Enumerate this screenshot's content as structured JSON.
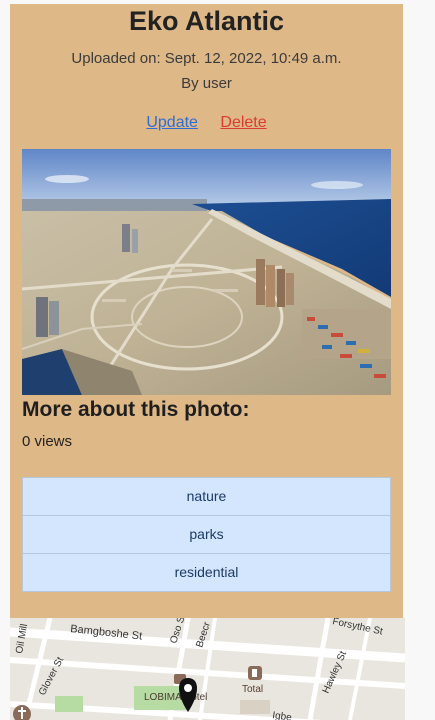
{
  "photo": {
    "title": "Eko Atlantic",
    "uploaded": "Uploaded on: Sept. 12, 2022, 10:49 a.m.",
    "byline": "By user",
    "image_alt": "Eko Atlantic"
  },
  "actions": {
    "update_label": "Update",
    "delete_label": "Delete"
  },
  "details": {
    "heading": "More about this photo:",
    "views": "0 views",
    "tags": [
      "nature",
      "parks",
      "residential"
    ]
  },
  "map": {
    "streets": [
      "Bamgboshe St",
      "Oso St",
      "Beecr",
      "Forsythe St",
      "Oil Mill",
      "Glover St",
      "Hawley St",
      "Total",
      "LOBIMA Hotel",
      "Igbe"
    ],
    "icons": [
      "location-pin-icon",
      "fuel-station-icon",
      "hotel-icon",
      "church-icon"
    ]
  },
  "colors": {
    "card_bg": "#dfb888",
    "tag_bg": "#d4e6fd",
    "update_link": "#2e6dd6",
    "delete_link": "#dc3b32"
  }
}
